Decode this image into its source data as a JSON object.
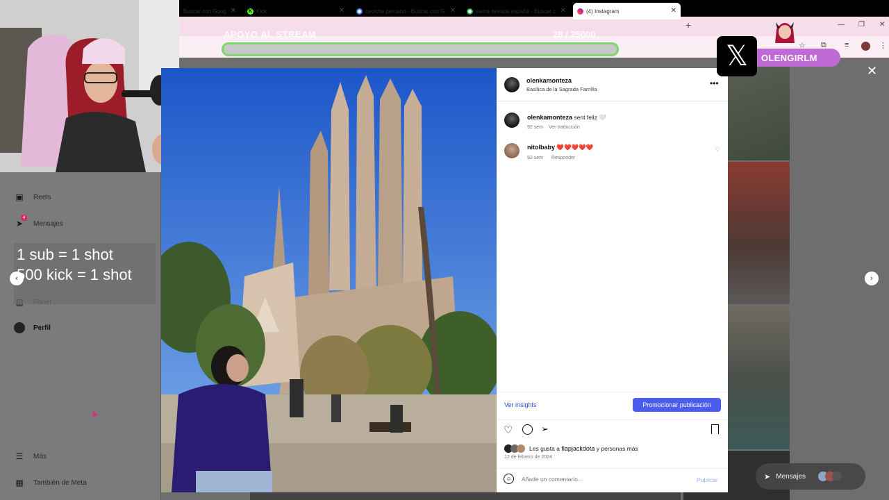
{
  "browser": {
    "tabs": [
      {
        "title": "Buscar con Goog",
        "favicon": "google-icon"
      },
      {
        "title": "Kick",
        "favicon": "kick-icon"
      },
      {
        "title": "ceviche peruano - Buscar con G",
        "favicon": "google-icon"
      },
      {
        "title": "sierra nevada españa - Buscar c",
        "favicon": "google-icon"
      },
      {
        "title": "(4) Instagram",
        "favicon": "instagram-icon"
      }
    ],
    "new_tab": "+"
  },
  "stream_overlay": {
    "goal_label": "APOYO AL STREAM",
    "goal_count": "28 / 25000",
    "goal_fraction": 0.0011,
    "shot_rules": [
      "1 sub = 1 shot",
      "500 kick = 1 shot"
    ],
    "x_handle": "OLENGIRLM"
  },
  "sidebar": {
    "items": [
      {
        "label": "Reels",
        "icon": "reels-icon"
      },
      {
        "label": "Mensajes",
        "icon": "messenger-icon",
        "badge": "4"
      },
      {
        "label": "Panel",
        "icon": "panel-icon"
      },
      {
        "label": "Perfil",
        "icon": "profile-avatar"
      },
      {
        "label": "Más",
        "icon": "menu-icon"
      },
      {
        "label": "También de Meta",
        "icon": "meta-icon"
      }
    ]
  },
  "post": {
    "username": "olenkamonteza",
    "location": "Basílica de la Sagrada Família",
    "caption_user": "olenkamonteza",
    "caption_text": "sent feliz 🤍",
    "caption_time": "92 sem",
    "caption_translate": "Ver traducción",
    "comment_user": "nitolbaby",
    "comment_text": "❤️❤️❤️❤️❤️",
    "comment_time": "92 sem",
    "comment_reply": "Responder",
    "insights_label": "Ver insights",
    "promote_label": "Promocionar publicación",
    "likes_prefix": "Les gusta a",
    "likes_user": "flapjackdota",
    "likes_suffix": "y personas más",
    "date": "12 de febrero de 2024",
    "comment_placeholder": "Añade un comentario...",
    "publish_label": "Publicar"
  },
  "chat_pill": {
    "label": "Mensajes"
  },
  "colors": {
    "accent": "#4a5df0",
    "tabstrip": "#f6ddea",
    "progress_border": "#7fd66d"
  }
}
